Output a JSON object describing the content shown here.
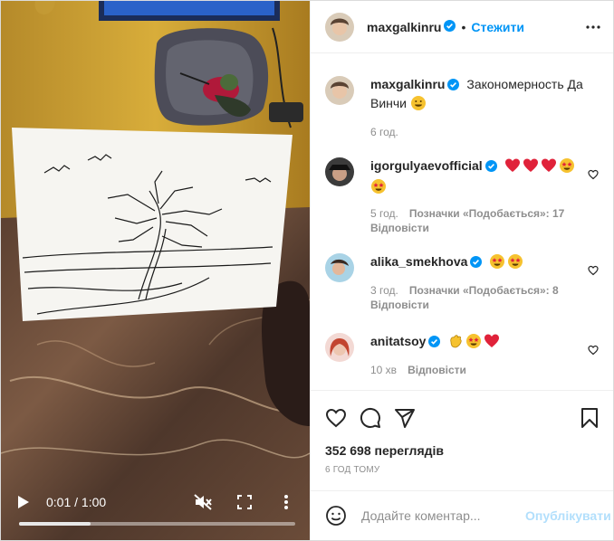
{
  "video": {
    "time_label": "0:01 / 1:00",
    "progress": 0.26
  },
  "header": {
    "username": "maxgalkinru",
    "separator": "•",
    "follow_label": "Стежити"
  },
  "caption": {
    "username": "maxgalkinru",
    "text": "Закономерность Да Винчи",
    "time": "6 год."
  },
  "comments": [
    {
      "username": "igorgulyaevofficial",
      "time": "5 год.",
      "likes": "Позначки «Подобається»: 17",
      "reply": "Відповісти"
    },
    {
      "username": "alika_smekhova",
      "time": "3 год.",
      "likes": "Позначки «Подобається»: 8",
      "reply": "Відповісти"
    },
    {
      "username": "anitatsoy",
      "time": "10 хв",
      "reply": "Відповісти"
    }
  ],
  "stats": {
    "views": "352 698 переглядів",
    "posted": "6 ГОД ТОМУ"
  },
  "composer": {
    "placeholder": "Додайте коментар...",
    "post_label": "Опублікувати"
  },
  "icons": {
    "verified": "verified-badge-icon",
    "more": "more-horizontal-icon",
    "like": "heart-icon",
    "comment": "comment-icon",
    "share": "share-icon",
    "save": "bookmark-icon",
    "emoji": "emoji-icon",
    "play": "play-icon",
    "mute": "mute-icon",
    "fullscreen": "fullscreen-icon",
    "video_menu": "more-vertical-icon"
  },
  "colors": {
    "accent": "#0095f6",
    "verified": "#0095f6",
    "muted_text": "#8e8e8e",
    "post_disabled": "#b2dffc"
  }
}
